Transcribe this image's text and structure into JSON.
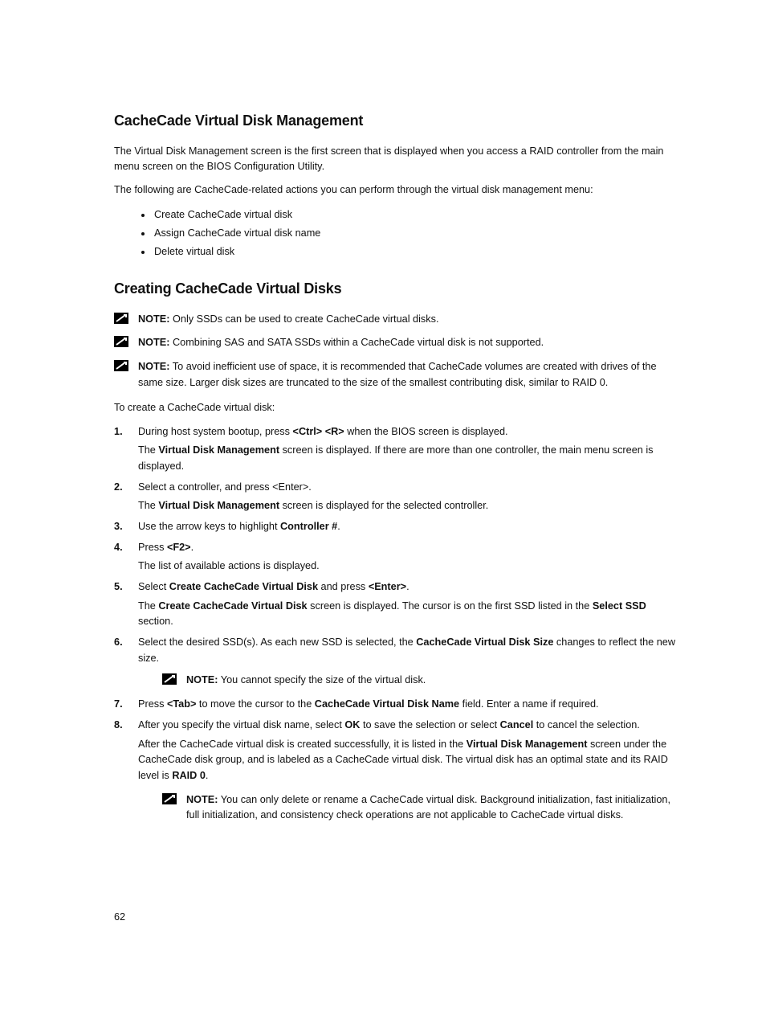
{
  "pageNumber": "62",
  "s1": {
    "heading": "CacheCade Virtual Disk Management",
    "p1": "The Virtual Disk Management screen is the first screen that is displayed when you access a RAID controller from the main menu screen on the BIOS Configuration Utility.",
    "p2": "The following are CacheCade-related actions you can perform through the virtual disk management menu:",
    "bullets": {
      "b1": "Create CacheCade virtual disk",
      "b2": "Assign CacheCade virtual disk name",
      "b3": "Delete virtual disk"
    }
  },
  "s2": {
    "heading": "Creating CacheCade Virtual Disks",
    "notes": {
      "label": "NOTE:",
      "n1": "Only SSDs can be used to create CacheCade virtual disks.",
      "n2": "Combining SAS and SATA SSDs within a CacheCade virtual disk is not supported.",
      "n3": "To avoid inefficient use of space, it is recommended that CacheCade volumes are created with drives of the same size. Larger disk sizes are truncated to the size of the smallest contributing disk, similar to RAID 0."
    },
    "intro": "To create a CacheCade virtual disk:",
    "steps": {
      "st1a": "During host system bootup, press ",
      "st1key": "<Ctrl> <R>",
      "st1b": " when the BIOS screen is displayed.",
      "st1c_a": "The ",
      "st1c_b": "Virtual Disk Management",
      "st1c_c": " screen is displayed. If there are more than one controller, the main menu screen is displayed.",
      "st2a": "Select a controller, and press <Enter>.",
      "st2b_a": "The ",
      "st2b_b": "Virtual Disk Management",
      "st2b_c": " screen is displayed for the selected controller.",
      "st3a": "Use the arrow keys to highlight ",
      "st3b": "Controller #",
      "st3c": ".",
      "st4a": "Press ",
      "st4b": "<F2>",
      "st4c": ".",
      "st4d": "The list of available actions is displayed.",
      "st5a": "Select ",
      "st5b": "Create CacheCade Virtual Disk",
      "st5c": " and press ",
      "st5d": "<Enter>",
      "st5e": ".",
      "st5f_a": "The ",
      "st5f_b": "Create CacheCade Virtual Disk",
      "st5f_c": " screen is displayed. The cursor is on the first SSD listed in the ",
      "st5f_d": "Select SSD",
      "st5f_e": " section.",
      "st6a": "Select the desired SSD(s). As each new SSD is selected, the ",
      "st6b": "CacheCade Virtual Disk Size",
      "st6c": " changes to reflect the new size.",
      "st6note": "You cannot specify the size of the virtual disk.",
      "st7a": "Press ",
      "st7b": "<Tab>",
      "st7c": " to move the cursor to the ",
      "st7d": "CacheCade Virtual Disk Name",
      "st7e": " field. Enter a name if required.",
      "st8a": "After you specify the virtual disk name, select ",
      "st8b": "OK",
      "st8c": " to save the selection or select ",
      "st8d": "Cancel",
      "st8e": " to cancel the selection.",
      "st8f_a": "After the CacheCade virtual disk is created successfully, it is listed in the ",
      "st8f_b": "Virtual Disk Management",
      "st8f_c": " screen under the CacheCade disk group, and is labeled as a CacheCade virtual disk. The virtual disk has an optimal state and its RAID level is ",
      "st8f_d": "RAID 0",
      "st8f_e": ".",
      "st8note": "You can only delete or rename a CacheCade virtual disk. Background initialization, fast initialization, full initialization, and consistency check operations are not applicable to CacheCade virtual disks."
    }
  }
}
